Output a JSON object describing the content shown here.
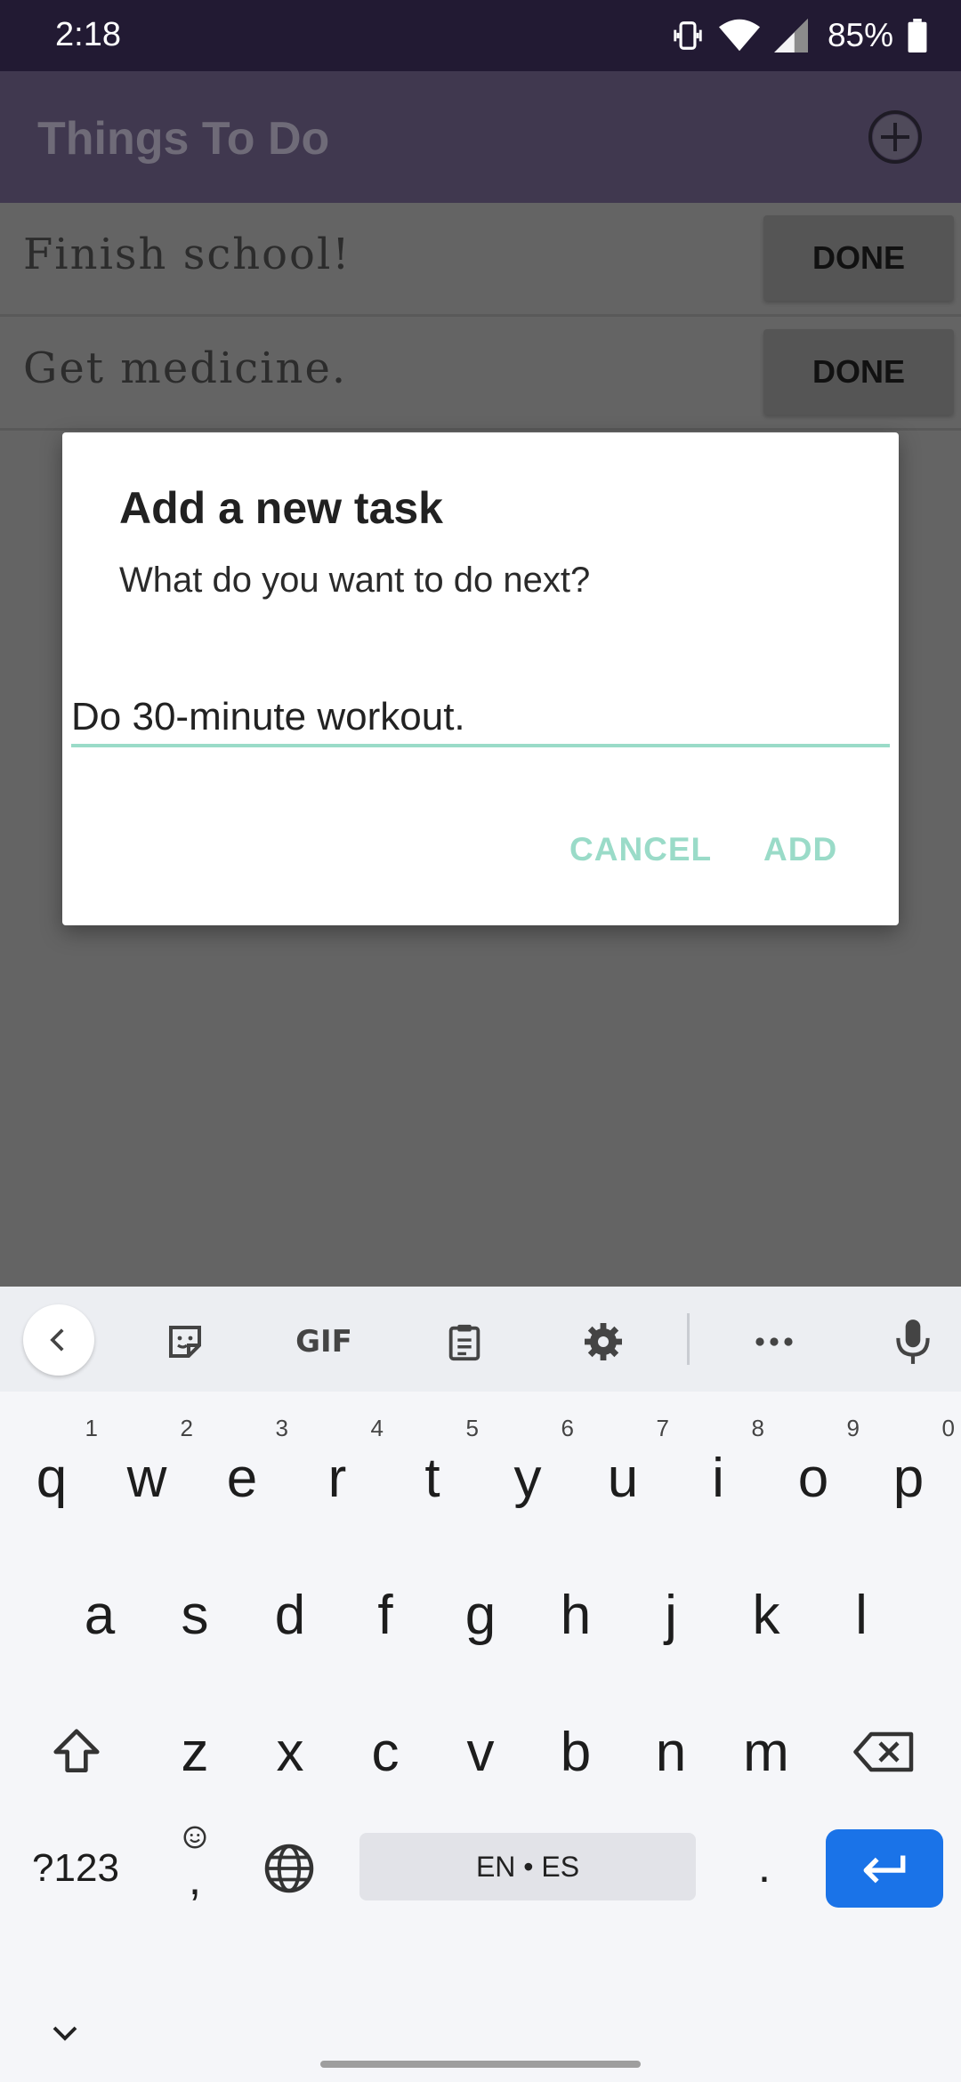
{
  "status_bar": {
    "time": "2:18",
    "battery": "85%"
  },
  "app": {
    "title": "Things To Do"
  },
  "tasks": [
    {
      "text": "Finish school!",
      "action": "DONE"
    },
    {
      "text": "Get medicine.",
      "action": "DONE"
    }
  ],
  "dialog": {
    "title": "Add a new task",
    "message": "What do you want to do next?",
    "input_value": "Do 30-minute workout.",
    "cancel_label": "CANCEL",
    "add_label": "ADD"
  },
  "keyboard": {
    "toolbar": {
      "gif_label": "GIF"
    },
    "row1": [
      {
        "key": "q",
        "hint": "1"
      },
      {
        "key": "w",
        "hint": "2"
      },
      {
        "key": "e",
        "hint": "3"
      },
      {
        "key": "r",
        "hint": "4"
      },
      {
        "key": "t",
        "hint": "5"
      },
      {
        "key": "y",
        "hint": "6"
      },
      {
        "key": "u",
        "hint": "7"
      },
      {
        "key": "i",
        "hint": "8"
      },
      {
        "key": "o",
        "hint": "9"
      },
      {
        "key": "p",
        "hint": "0"
      }
    ],
    "row2": [
      "a",
      "s",
      "d",
      "f",
      "g",
      "h",
      "j",
      "k",
      "l"
    ],
    "row3": [
      "z",
      "x",
      "c",
      "v",
      "b",
      "n",
      "m"
    ],
    "symbols_label": "?123",
    "comma_label": ",",
    "space_label": "EN • ES",
    "period_label": "."
  },
  "colors": {
    "accent": "#9adbc8",
    "app_bar": "#40384f",
    "status_bar": "#221a33",
    "enter_key": "#1a73e8"
  }
}
